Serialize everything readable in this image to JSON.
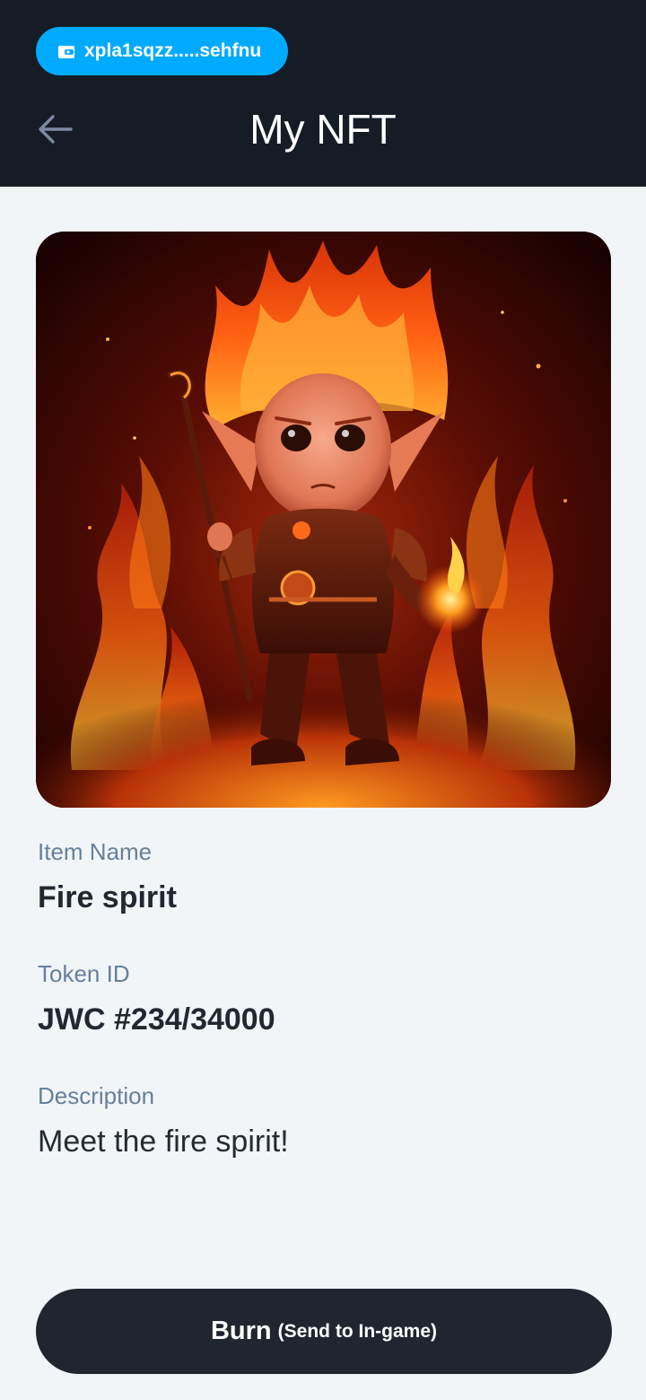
{
  "header": {
    "wallet_address": "xpla1sqzz.....sehfnu",
    "title": "My NFT"
  },
  "nft": {
    "item_name_label": "Item Name",
    "item_name": "Fire spirit",
    "token_id_label": "Token ID",
    "token_id": "JWC #234/34000",
    "description_label": "Description",
    "description": "Meet the fire spirit!"
  },
  "actions": {
    "burn_label": "Burn",
    "burn_sub_label": "(Send to In-game)"
  },
  "icons": {
    "wallet": "wallet-icon",
    "back": "arrow-left-icon"
  },
  "colors": {
    "header_bg": "#161c26",
    "wallet_chip": "#00aaff",
    "page_bg": "#f2f5f8",
    "label_text": "#66809c",
    "button_bg": "#20252f"
  }
}
